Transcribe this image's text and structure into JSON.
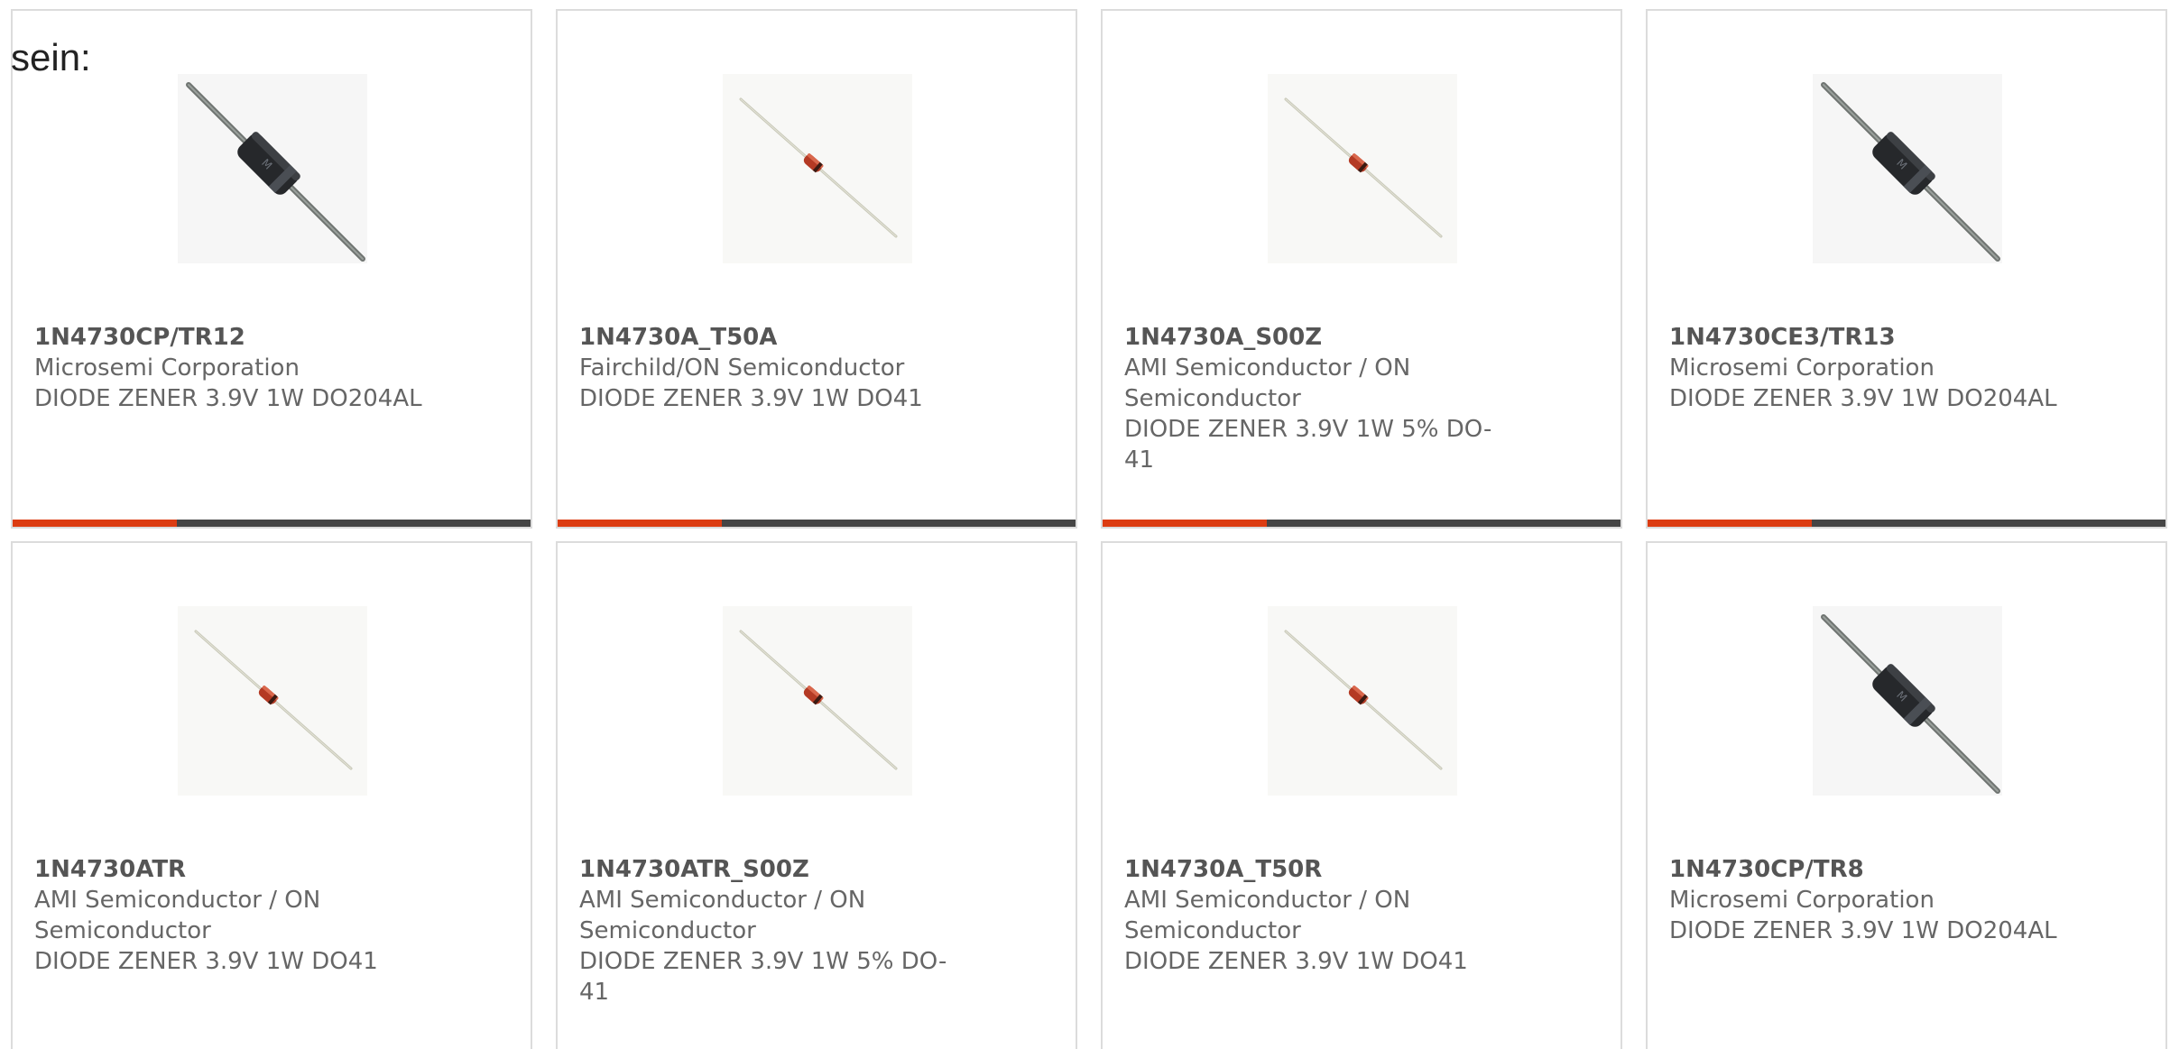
{
  "intro": "sein:",
  "colors": {
    "accent_bar": "#dc3c12",
    "dark_bar": "#454545",
    "card_border": "#dcdcdc",
    "text": "#666666"
  },
  "products": [
    {
      "part_number": "1N4730CP/TR12",
      "manufacturer": "Microsemi Corporation",
      "description": "DIODE ZENER 3.9V 1W DO204AL",
      "image": "do204al-diode-image"
    },
    {
      "part_number": "1N4730A_T50A",
      "manufacturer": "Fairchild/ON Semiconductor",
      "description": "DIODE ZENER 3.9V 1W DO41",
      "image": "do41-diode-image"
    },
    {
      "part_number": "1N4730A_S00Z",
      "manufacturer": "AMI Semiconductor / ON Semiconductor",
      "description": "DIODE ZENER 3.9V 1W 5% DO-41",
      "image": "do41-diode-image"
    },
    {
      "part_number": "1N4730CE3/TR13",
      "manufacturer": "Microsemi Corporation",
      "description": "DIODE ZENER 3.9V 1W DO204AL",
      "image": "do204al-diode-image"
    },
    {
      "part_number": "1N4730ATR",
      "manufacturer": "AMI Semiconductor / ON Semiconductor",
      "description": "DIODE ZENER 3.9V 1W DO41",
      "image": "do41-diode-image"
    },
    {
      "part_number": "1N4730ATR_S00Z",
      "manufacturer": "AMI Semiconductor / ON Semiconductor",
      "description": "DIODE ZENER 3.9V 1W 5% DO-41",
      "image": "do41-diode-image"
    },
    {
      "part_number": "1N4730A_T50R",
      "manufacturer": "AMI Semiconductor / ON Semiconductor",
      "description": "DIODE ZENER 3.9V 1W DO41",
      "image": "do41-diode-image"
    },
    {
      "part_number": "1N4730CP/TR8",
      "manufacturer": "Microsemi Corporation",
      "description": "DIODE ZENER 3.9V 1W DO204AL",
      "image": "do204al-diode-image"
    }
  ]
}
